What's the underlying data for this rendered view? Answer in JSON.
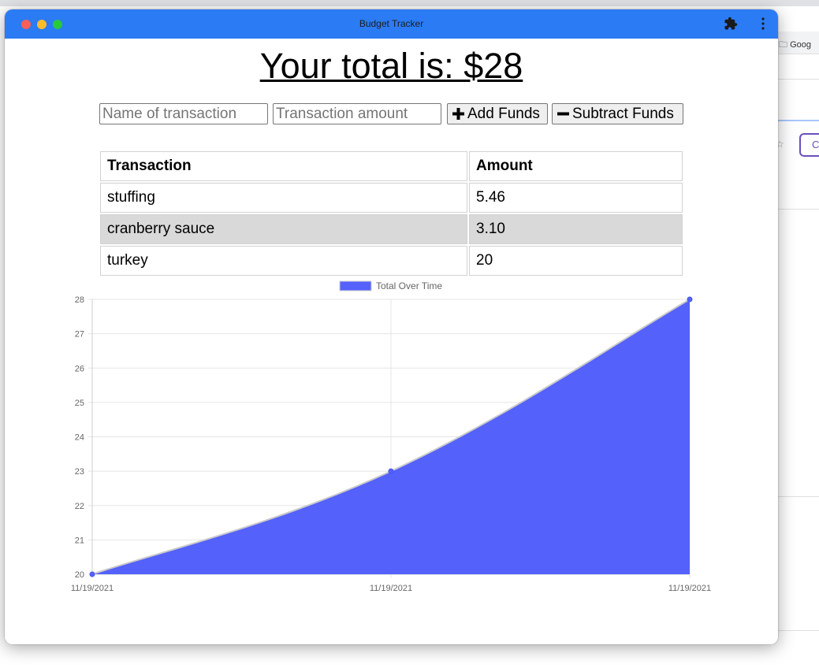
{
  "window": {
    "title": "Budget Tracker"
  },
  "background": {
    "bookmark_folder": "Goog",
    "side_button": "C"
  },
  "header": {
    "total_text": "Your total is: $28"
  },
  "form": {
    "name_placeholder": "Name of transaction",
    "amount_placeholder": "Transaction amount",
    "add_label": "Add Funds",
    "subtract_label": "Subtract Funds"
  },
  "table": {
    "headers": [
      "Transaction",
      "Amount"
    ],
    "rows": [
      {
        "name": "stuffing",
        "amount": "5.46"
      },
      {
        "name": "cranberry sauce",
        "amount": "3.10"
      },
      {
        "name": "turkey",
        "amount": "20"
      }
    ]
  },
  "colors": {
    "titlebar": "#2b7bf4",
    "chart_fill": "#5461fb",
    "row_alt": "#d9d9d9"
  },
  "chart_data": {
    "type": "area",
    "series": [
      {
        "name": "Total Over Time",
        "values": [
          20,
          23,
          28
        ]
      }
    ],
    "categories": [
      "11/19/2021",
      "11/19/2021",
      "11/19/2021"
    ],
    "ylim": [
      20,
      28
    ],
    "yticks": [
      20,
      21,
      22,
      23,
      24,
      25,
      26,
      27,
      28
    ],
    "grid": true,
    "legend": "top-center"
  }
}
